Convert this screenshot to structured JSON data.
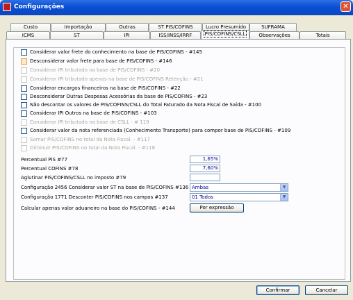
{
  "window": {
    "title": "Configurações",
    "close_glyph": "✕"
  },
  "tabs_row1": [
    "Custo",
    "Importação",
    "Outras",
    "ST PIS/COFINS",
    "Lucro Presumido",
    "SUFRAMA"
  ],
  "tabs_row2": [
    "ICMS",
    "ST",
    "IPI",
    "ISS/INSS/IRRF",
    "PIS/COFINS/CSLL",
    "Observações",
    "Totais"
  ],
  "checkboxes": [
    {
      "label": "Considerar valor frete do conhecimento na base de PIS/COFINS - #145",
      "enabled": true,
      "checked": false
    },
    {
      "label": "Desconsiderar valor frete para base de PIS/COFINS - #146",
      "enabled": true,
      "checked": false,
      "highlight": true
    },
    {
      "label": "Considerar IPI tributado na base de PIS/COFINS - #20",
      "enabled": false,
      "checked": false
    },
    {
      "label": "Considerar IPI tributado apenas na base de PIS/COFINS Retenção - #21",
      "enabled": false,
      "checked": false
    },
    {
      "label": "Considerar encargos financeiros na base de PIS/COFINS - #22",
      "enabled": true,
      "checked": false
    },
    {
      "label": "Desconsiderar Outras Despesas Acessórias da base de PIS/COFINS - #23",
      "enabled": true,
      "checked": false
    },
    {
      "label": "Não descontar os valores de PIS/COFINS/CSLL do Total Faturado da Nota Fiscal de Saída - #100",
      "enabled": true,
      "checked": false
    },
    {
      "label": "Considerar IPI Outros na base de PIS/COFINS - #103",
      "enabled": true,
      "checked": false
    },
    {
      "label": "Considerar IPI tributado na base de CSLL - # 119",
      "enabled": false,
      "checked": false
    },
    {
      "label": "Considerar valor da nota referenciada (Conhecimento Transporte) para compor base de PIS/COFINS - #109",
      "enabled": true,
      "checked": false
    },
    {
      "label": "Somar PIS/COFINS no total da Nota Fiscal. - #117",
      "enabled": false,
      "checked": false
    },
    {
      "label": "Diminuir PIS/COFINS no total da Nota Fiscal. - #118",
      "enabled": false,
      "checked": false
    }
  ],
  "fields": {
    "pis": {
      "label": "Percentual PIS #77",
      "value": "1,65%"
    },
    "cofins": {
      "label": "Percentual COFINS #78",
      "value": "7,60%"
    },
    "aglutinar": {
      "label": "Aglutinar PIS/COFINS/CSLL no imposto #79",
      "value": ""
    },
    "config2456": {
      "label": "Configuração 2456 Considerar valor ST na base de PIS/COFINS #136",
      "value": "Ambas"
    },
    "config1771": {
      "label": "Configuração 1771 Desconter PIS/COFINS nos campos #137",
      "value": "01 Todos"
    },
    "calcular": {
      "label": "Calcular apenas valor aduaneiro na base do PIS/COFINS - #144",
      "button": "Por expressão"
    }
  },
  "footer": {
    "confirm": "Confirmar",
    "cancel": "Cancelar"
  },
  "colors": {
    "titlebar": "#0a4fd6",
    "background": "#ece9d8",
    "value_text": "#00008b"
  }
}
